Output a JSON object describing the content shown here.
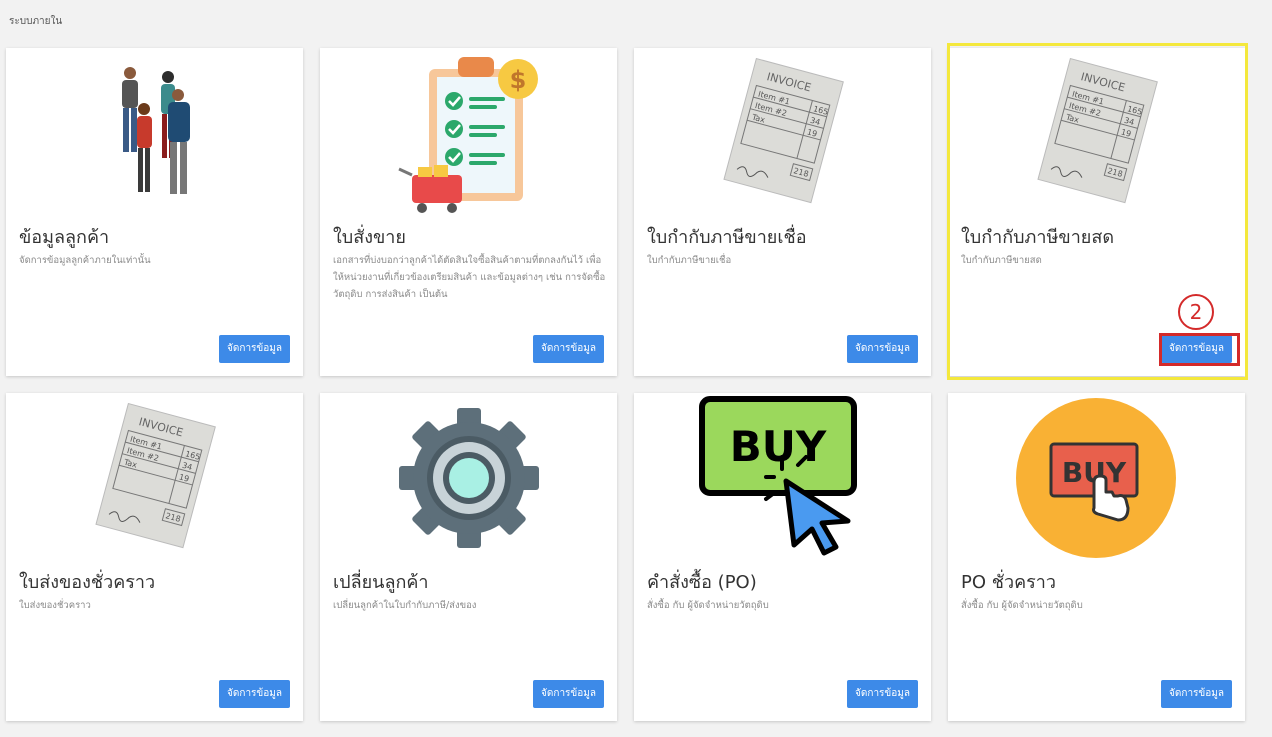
{
  "page": {
    "title": "ระบบภายใน"
  },
  "cards": [
    {
      "title": "ข้อมูลลูกค้า",
      "desc": "จัดการข้อมูลลูกค้าภายในเท่านั้น",
      "button": "จัดการข้อมูล",
      "icon": "people-icon"
    },
    {
      "title": "ใบสั่งขาย",
      "desc": "เอกสารที่บ่งบอกว่าลูกค้าได้ตัดสินใจซื้อสินค้าตามที่ตกลงกันไว้ เพื่อให้หน่วยงานที่เกี่ยวข้องเตรียมสินค้า และข้อมูลต่างๆ เช่น การจัดซื้อวัตถุดิบ การส่งสินค้า เป็นต้น",
      "button": "จัดการข้อมูล",
      "icon": "checklist-icon"
    },
    {
      "title": "ใบกำกับภาษีขายเชื่อ",
      "desc": "ใบกำกับภาษีขายเชื่อ",
      "button": "จัดการข้อมูล",
      "icon": "invoice-icon"
    },
    {
      "title": "ใบกำกับภาษีขายสด",
      "desc": "ใบกำกับภาษีขายสด",
      "button": "จัดการข้อมูล",
      "icon": "invoice-icon"
    },
    {
      "title": "ใบส่งของชั่วคราว",
      "desc": "ใบส่งของชั่วคราว",
      "button": "จัดการข้อมูล",
      "icon": "invoice-icon"
    },
    {
      "title": "เปลี่ยนลูกค้า",
      "desc": "เปลี่ยนลูกค้าในใบกำกับภาษี/ส่งของ",
      "button": "จัดการข้อมูล",
      "icon": "gear-icon"
    },
    {
      "title": "คำสั่งซื้อ (PO)",
      "desc": "สั่งซื้อ กับ ผู้จัดจำหน่ายวัตถุดิบ",
      "button": "จัดการข้อมูล",
      "icon": "buy-click-icon"
    },
    {
      "title": "PO ชั่วคราว",
      "desc": "สั่งซื้อ กับ ผู้จัดจำหน่ายวัตถุดิบ",
      "button": "จัดการข้อมูล",
      "icon": "buy-circle-icon"
    }
  ],
  "annotation": {
    "step": "2"
  },
  "invoice_art": {
    "heading": "INVOICE",
    "row1": "Item #1",
    "row2": "Item #2",
    "row3": "Tax",
    "v1": "165",
    "v2": "34",
    "v3": "19",
    "total": "218"
  },
  "buy_art": {
    "label": "BUY"
  },
  "colors": {
    "button": "#3d8ae8",
    "highlight_yellow": "#f4e83c",
    "highlight_red": "#d42a2a"
  }
}
